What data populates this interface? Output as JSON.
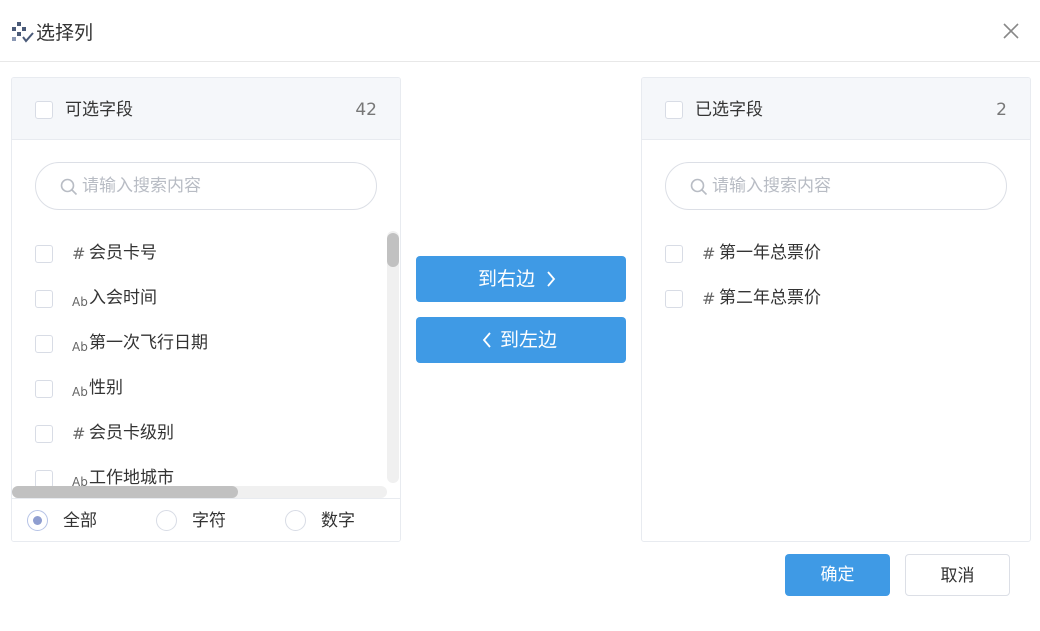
{
  "dialog": {
    "title": "选择列",
    "icon": "grid-check-icon",
    "close_icon": "close-icon"
  },
  "left_panel": {
    "header_label": "可选字段",
    "count": "42",
    "search_placeholder": "请输入搜索内容",
    "items": [
      {
        "type_symbol": "#",
        "label": "会员卡号"
      },
      {
        "type_symbol": "Ab",
        "label": "入会时间"
      },
      {
        "type_symbol": "Ab",
        "label": "第一次飞行日期"
      },
      {
        "type_symbol": "Ab",
        "label": "性别"
      },
      {
        "type_symbol": "#",
        "label": "会员卡级别"
      },
      {
        "type_symbol": "Ab",
        "label": "工作地城市"
      }
    ],
    "filters": [
      {
        "label": "全部",
        "checked": true
      },
      {
        "label": "字符",
        "checked": false
      },
      {
        "label": "数字",
        "checked": false
      }
    ]
  },
  "right_panel": {
    "header_label": "已选字段",
    "count": "2",
    "search_placeholder": "请输入搜索内容",
    "items": [
      {
        "type_symbol": "#",
        "label": "第一年总票价"
      },
      {
        "type_symbol": "#",
        "label": "第二年总票价"
      }
    ]
  },
  "transfer": {
    "to_right_label": "到右边",
    "to_left_label": "到左边"
  },
  "footer": {
    "confirm_label": "确定",
    "cancel_label": "取消"
  },
  "colors": {
    "primary": "#3f9ae5",
    "panel_header_bg": "#f5f7fa",
    "radio_checked": "#8f9ed0"
  }
}
